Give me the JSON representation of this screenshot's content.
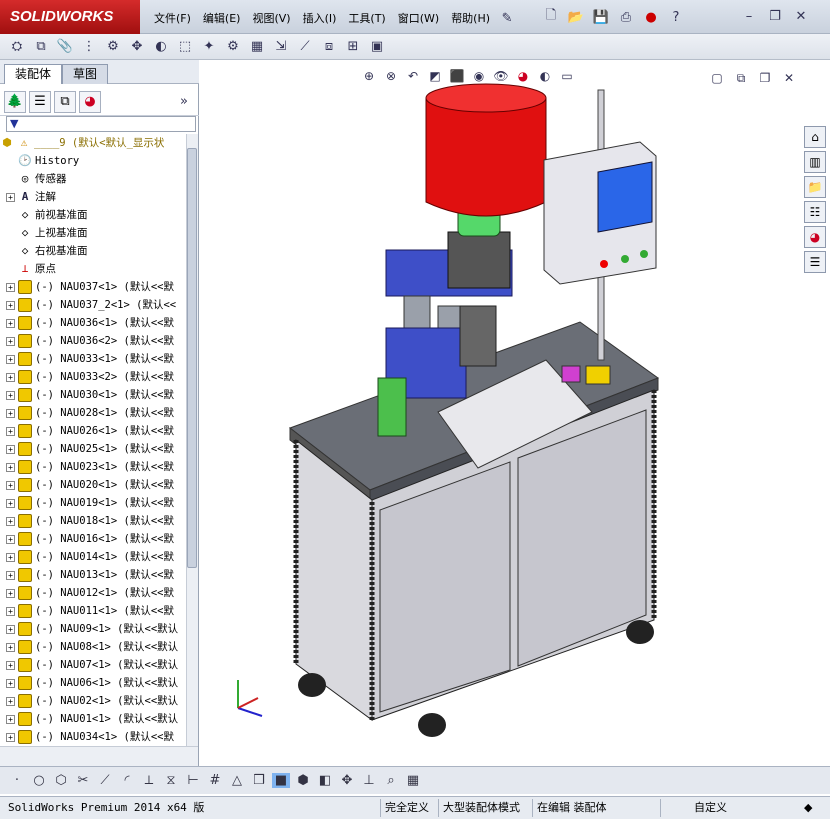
{
  "app": {
    "logo": "SOLIDWORKS"
  },
  "menu": [
    {
      "label": "文件(F)"
    },
    {
      "label": "编辑(E)"
    },
    {
      "label": "视图(V)"
    },
    {
      "label": "插入(I)"
    },
    {
      "label": "工具(T)"
    },
    {
      "label": "窗口(W)"
    },
    {
      "label": "帮助(H)"
    }
  ],
  "tabs": {
    "assembly": "装配体",
    "sketch": "草图"
  },
  "tree": {
    "root": "____9  (默认<默认_显示状",
    "history": "History",
    "sensors": "传感器",
    "annotations": "注解",
    "front_plane": "前视基准面",
    "top_plane": "上视基准面",
    "right_plane": "右视基准面",
    "origin": "原点",
    "parts": [
      "(-) NAU037<1> (默认<<默",
      "(-) NAU037_2<1> (默认<<",
      "(-) NAU036<1> (默认<<默",
      "(-) NAU036<2> (默认<<默",
      "(-) NAU033<1> (默认<<默",
      "(-) NAU033<2> (默认<<默",
      "(-) NAU030<1> (默认<<默",
      "(-) NAU028<1> (默认<<默",
      "(-) NAU026<1> (默认<<默",
      "(-) NAU025<1> (默认<<默",
      "(-) NAU023<1> (默认<<默",
      "(-) NAU020<1> (默认<<默",
      "(-) NAU019<1> (默认<<默",
      "(-) NAU018<1> (默认<<默",
      "(-) NAU016<1> (默认<<默",
      "(-) NAU014<1> (默认<<默",
      "(-) NAU013<1> (默认<<默",
      "(-) NAU012<1> (默认<<默",
      "(-) NAU011<1> (默认<<默",
      "(-) NAU09<1> (默认<<默认",
      "(-) NAU08<1> (默认<<默认",
      "(-) NAU07<1> (默认<<默认",
      "(-) NAU06<1> (默认<<默认",
      "(-) NAU02<1> (默认<<默认",
      "(-) NAU01<1> (默认<<默认",
      "(-) NAU034<1> (默认<<默"
    ]
  },
  "status": {
    "product": "SolidWorks Premium 2014 x64 版",
    "underdefined": "完全定义",
    "mode": "大型装配体模式",
    "editing": "在编辑 装配体",
    "custom": "自定义"
  },
  "colors": {
    "accent": "#c8102e",
    "hopper": "#e01010",
    "base": "#4a5ac8",
    "green": "#3c9a3c"
  }
}
